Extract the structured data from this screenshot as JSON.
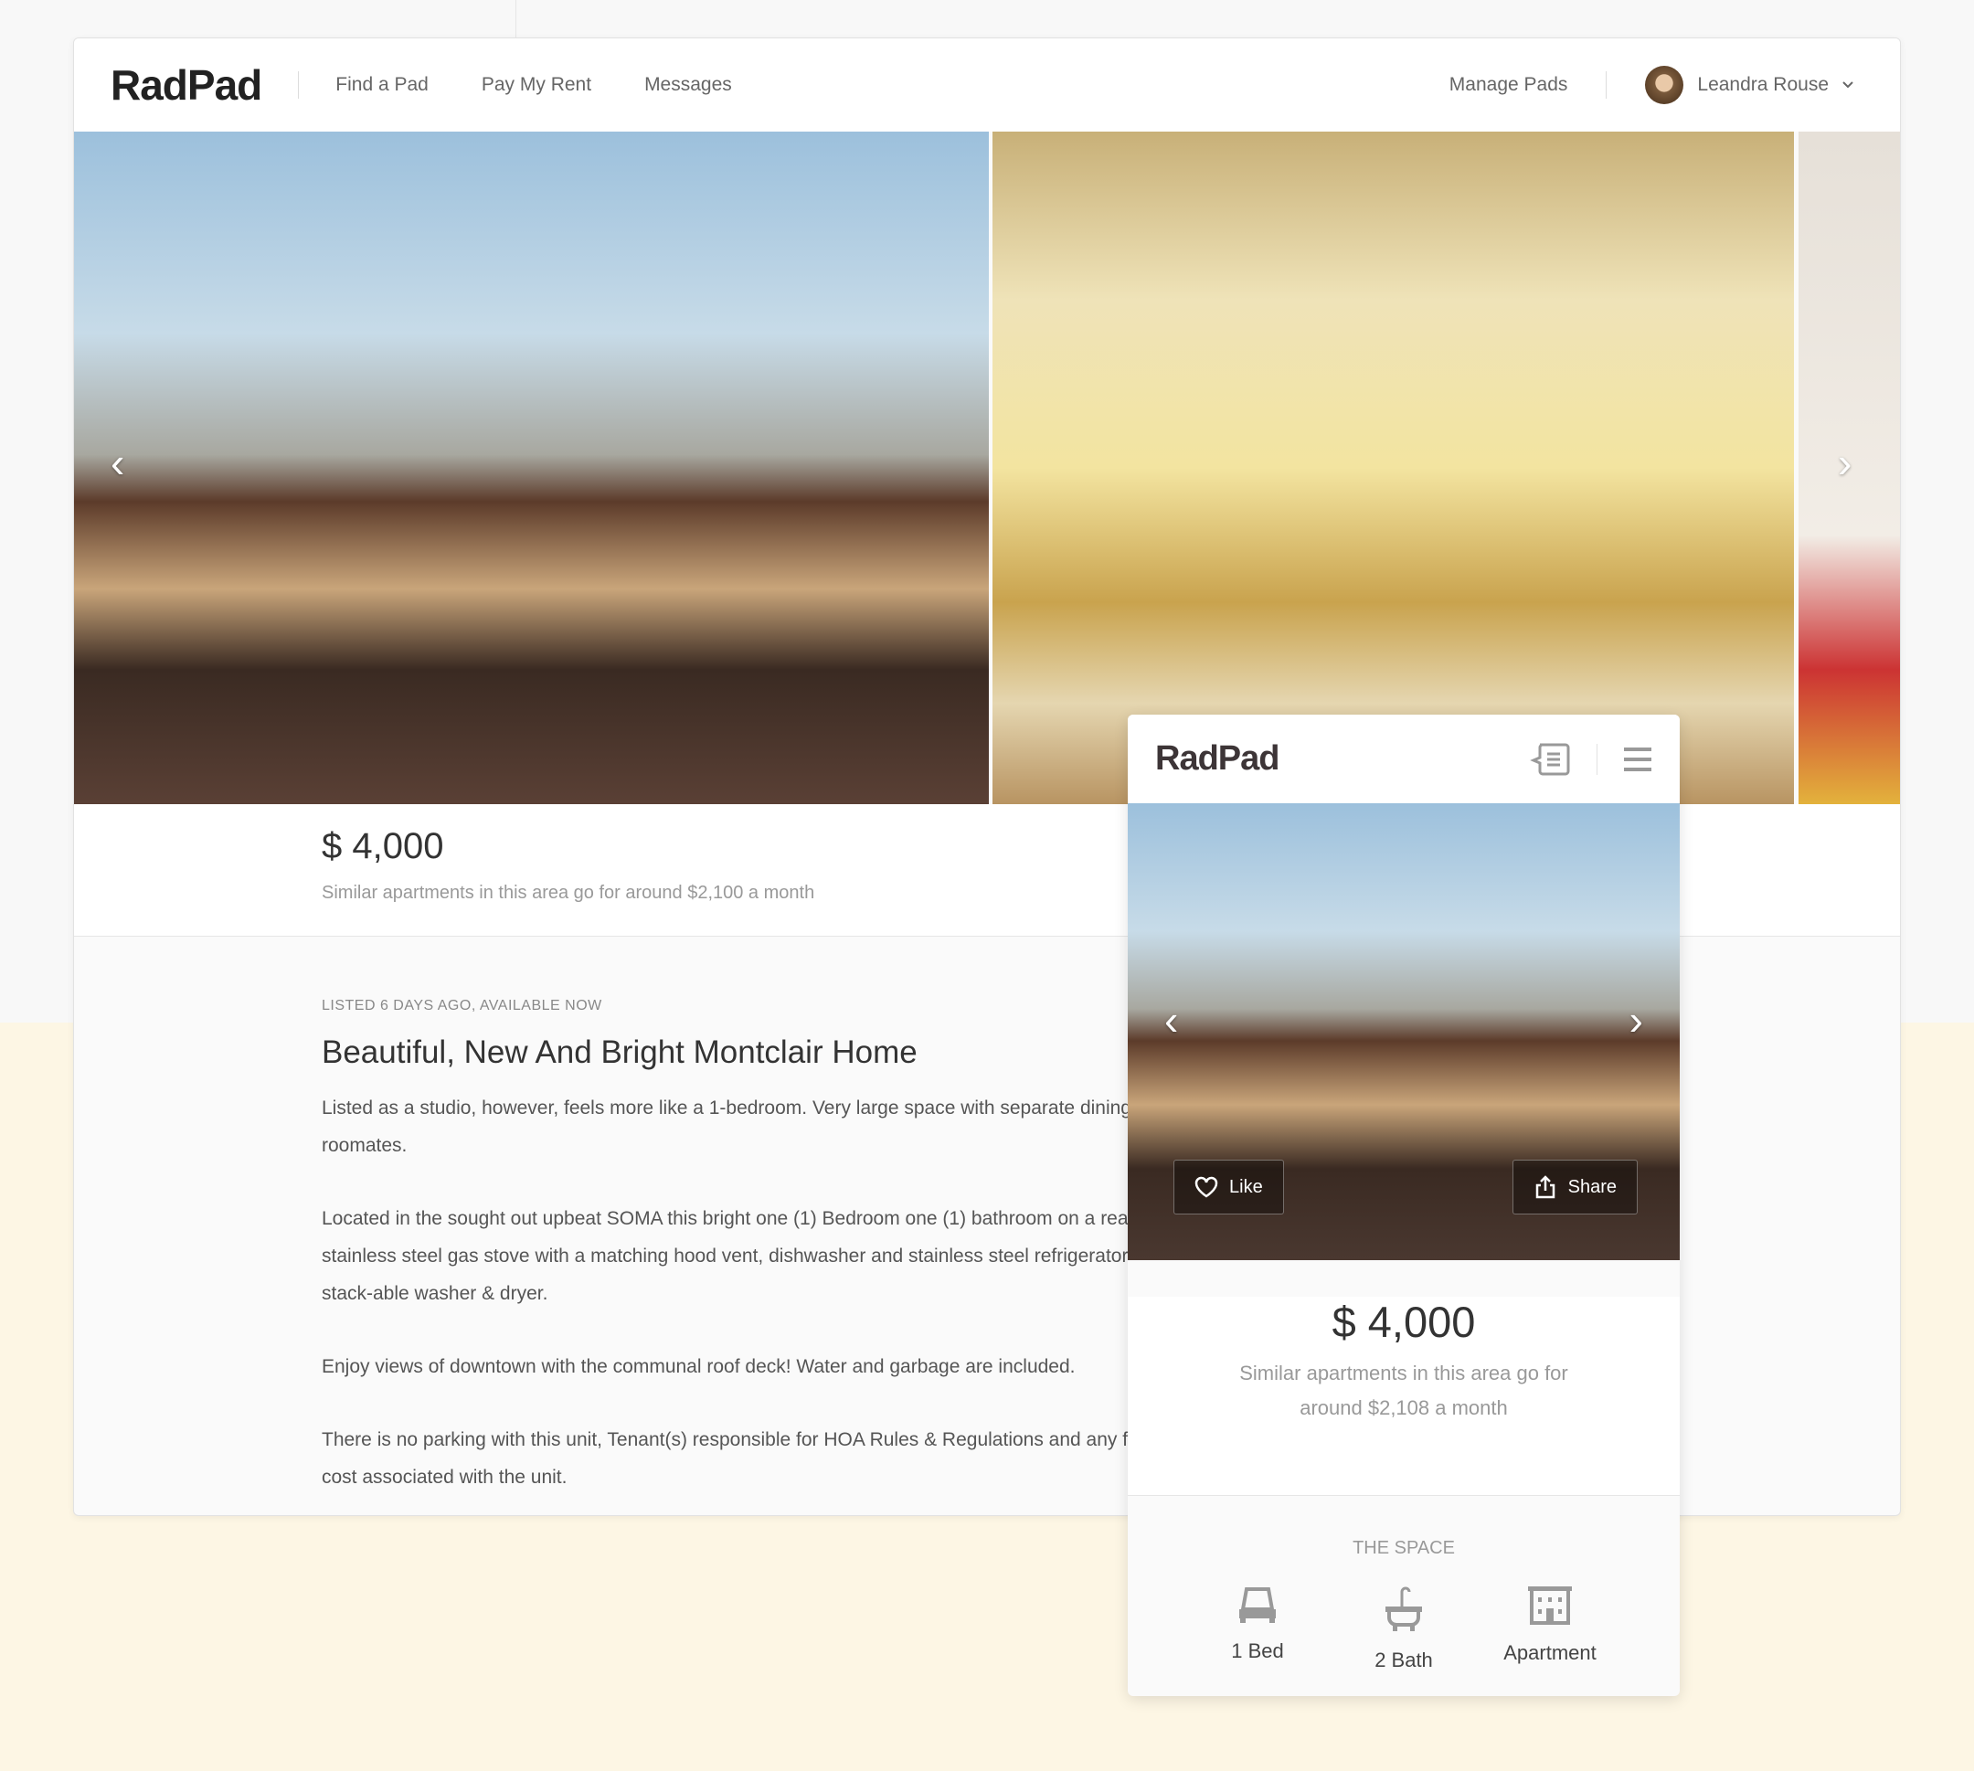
{
  "header": {
    "logo": "RadPad",
    "nav": [
      "Find a Pad",
      "Pay My Rent",
      "Messages"
    ],
    "manage": "Manage Pads",
    "user": "Leandra Rouse"
  },
  "listing": {
    "price": "$ 4,000",
    "similar": "Similar apartments in this area go for around $2,100 a month",
    "listed": "LISTED 6 DAYS AGO, AVAILABLE NOW",
    "title": "Beautiful, New And Bright Montclair Home",
    "paragraphs": [
      "Listed as a studio, however, feels more like a 1-bedroom. Very large space with separate dining area. Comfortably accomodate a couple or 3 roomates.",
      "Located in the sought out upbeat SOMA this bright one (1) Bedroom one (1) bathroom on a rear facing unit featuring beautiful granite counter tops, stainless steel gas stove with a matching hood vent, dishwasher and stainless steel refrigerator. To add to the beautiful features of this unit an in unit stack-able washer & dryer.",
      "Enjoy views of downtown with the communal roof deck! Water and garbage are included.",
      "There is no parking with this unit, Tenant(s) responsible for HOA Rules & Regulations and any fees for any violations, refundable move in/move out cost associated with the unit."
    ]
  },
  "mobile": {
    "logo": "RadPad",
    "like": "Like",
    "share": "Share",
    "price": "$ 4,000",
    "similar": "Similar apartments in this area go for around $2,108 a month",
    "space_title": "THE SPACE",
    "features": [
      "1 Bed",
      "2 Bath",
      "Apartment"
    ]
  }
}
